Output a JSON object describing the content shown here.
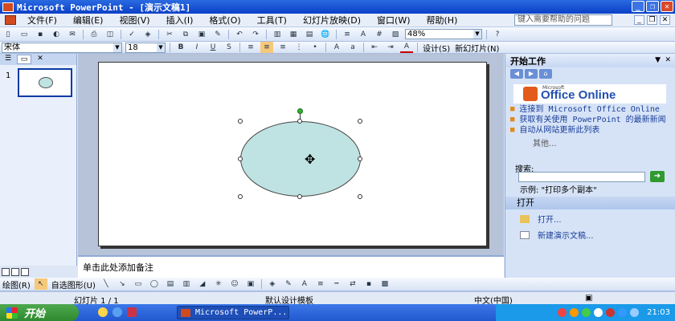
{
  "window": {
    "title": "Microsoft PowerPoint - [演示文稿1]"
  },
  "menubar": {
    "items": [
      "文件(F)",
      "编辑(E)",
      "视图(V)",
      "插入(I)",
      "格式(O)",
      "工具(T)",
      "幻灯片放映(D)",
      "窗口(W)",
      "帮助(H)"
    ],
    "help_placeholder": "键入需要帮助的问题"
  },
  "toolbar1": {
    "zoom": "48%"
  },
  "toolbar2": {
    "font_name": "宋体",
    "font_size": "18",
    "design_label": "设计(S)",
    "new_slide_label": "新幻灯片(N)"
  },
  "slide_pane": {
    "slide_number": "1"
  },
  "notes": {
    "placeholder": "单击此处添加备注"
  },
  "taskpane": {
    "title": "开始工作",
    "office_logo_small": "Microsoft",
    "office_logo": "Office Online",
    "links": [
      "连接到 Microsoft Office Online",
      "获取有关使用 PowerPoint 的最新新闻",
      "自动从网站更新此列表"
    ],
    "more": "其他...",
    "search_label": "搜索:",
    "example": "示例: \"打印多个副本\"",
    "open_header": "打开",
    "open_items": [
      "打开...",
      "新建演示文稿..."
    ]
  },
  "drawbar": {
    "draw_label": "绘图(R)",
    "autoshape_label": "自选图形(U)"
  },
  "statusbar": {
    "slide": "幻灯片 1 / 1",
    "template": "默认设计模板",
    "language": "中文(中国)"
  },
  "taskbar": {
    "start_label": "开始",
    "app_label": "Microsoft PowerP...",
    "clock": "21:03"
  },
  "colors": {
    "shape_fill": "#bfe3e2",
    "title_bar": "#0a40c8"
  }
}
